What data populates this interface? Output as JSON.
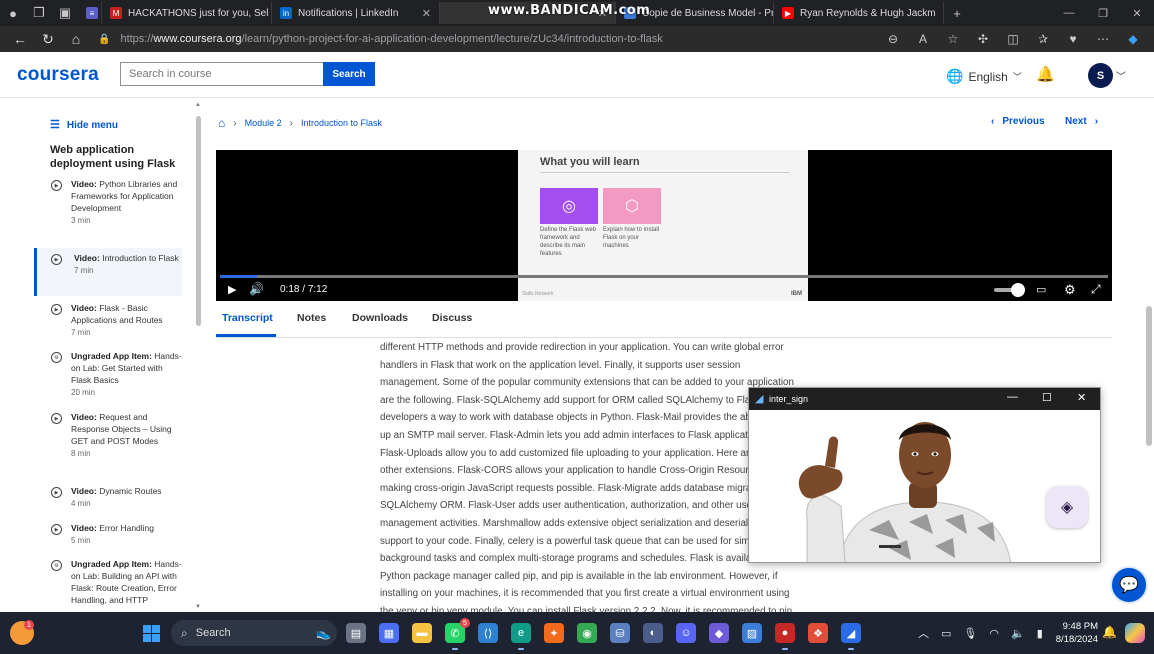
{
  "browser": {
    "tabs": [
      {
        "title": "HACKATHONS just for you, Sel",
        "favicon": "gmail-icon",
        "color": "#c5221f"
      },
      {
        "title": "Notifications | LinkedIn",
        "favicon": "linkedin-icon",
        "color": "#0a66c2"
      },
      {
        "title": "Copie de Business Model - Pré",
        "favicon": "doc-icon",
        "color": "#3a7bd5"
      },
      {
        "title": "Ryan Reynolds & Hugh Jackm",
        "favicon": "youtube-icon",
        "color": "#ff0000"
      }
    ],
    "url_prefix": "https://",
    "url_host": "www.coursera.org",
    "url_path": "/learn/python-project-for-ai-application-development/lecture/zUc34/introduction-to-flask",
    "watermark": "www.BANDICAM.com"
  },
  "header": {
    "logo": "coursera",
    "search_placeholder": "Search in course",
    "search_button": "Search",
    "language": "English",
    "avatar_initial": "S"
  },
  "sidebar": {
    "hide_menu": "Hide menu",
    "course_title": "Web application deployment using Flask",
    "items": [
      {
        "kind": "Video:",
        "title": "Python Libraries and Frameworks for Application Development",
        "duration": "3 min"
      },
      {
        "kind": "Video:",
        "title": "Introduction to Flask",
        "duration": "7 min"
      },
      {
        "kind": "Video:",
        "title": "Flask - Basic Applications and Routes",
        "duration": "7 min"
      },
      {
        "kind": "Ungraded App Item:",
        "title": "Hands-on Lab: Get Started with Flask Basics",
        "duration": "20 min"
      },
      {
        "kind": "Video:",
        "title": "Request and Response Objects – Using GET and POST Modes",
        "duration": "8 min"
      },
      {
        "kind": "Video:",
        "title": "Dynamic Routes",
        "duration": "4 min"
      },
      {
        "kind": "Video:",
        "title": "Error Handling",
        "duration": "5 min"
      },
      {
        "kind": "Ungraded App Item:",
        "title": "Hands-on Lab: Building an API with Flask: Route Creation, Error Handling, and HTTP",
        "duration": ""
      }
    ]
  },
  "breadcrumb": {
    "module": "Module 2",
    "current": "Introduction to Flask"
  },
  "pager": {
    "previous": "Previous",
    "next": "Next"
  },
  "video": {
    "slide_title": "What you will learn",
    "cards": [
      {
        "text": "Define the Flask web framework and describe its main features",
        "color": "#a44ef0"
      },
      {
        "text": "Explain how to install Flask on your machines",
        "color": "#f49ac2"
      }
    ],
    "slide_footer": "Skills Network",
    "slide_brand": "IBM",
    "current_time": "0:18",
    "time_sep": "/",
    "duration": "7:12",
    "progress": 0.042
  },
  "content_tabs": [
    "Transcript",
    "Notes",
    "Downloads",
    "Discuss"
  ],
  "transcript": [
    "different HTTP methods and provide redirection in your application. You can write global error",
    "handlers in Flask that work on the application level. Finally, it supports user session",
    "management. Some of the popular community extensions that can be added to your application",
    "are the following. Flask-SQLAlchemy add support for ORM called SQLAlchemy to Flask, giving",
    "developers a way to work with database objects in Python. Flask-Mail provides the ability to set",
    "up an SMTP mail server. Flask-Admin lets you add admin interfaces to Flask applications easily.",
    "Flask-Uploads allow you to add customized file uploading to your application. Here are some",
    "other extensions. Flask-CORS allows your application to handle Cross-Origin Resource Sharing,",
    "making cross-origin JavaScript requests possible. Flask-Migrate adds database migrations to",
    "SQLAlchemy ORM. Flask-User adds user authentication, authorization, and other user",
    "management activities. Marshmallow adds extensive object serialization and deserialization",
    "support to your code. Finally, celery is a powerful task queue that can be used for simple",
    "background tasks and complex multi-storage programs and schedules. Flask is available in the",
    "Python package manager called pip, and pip is available in the lab environment. However, if",
    "installing on your machines, it is recommended that you first create a virtual environment using",
    "the venv or bin venv module. You can install Flask version 2.2.2. Now, it is recommended to pin"
  ],
  "float_window": {
    "title": "inter_sign"
  },
  "taskbar": {
    "search": "Search",
    "weather_badge": "1",
    "whatsapp_badge": "5",
    "time": "9:48 PM",
    "date": "8/18/2024"
  }
}
